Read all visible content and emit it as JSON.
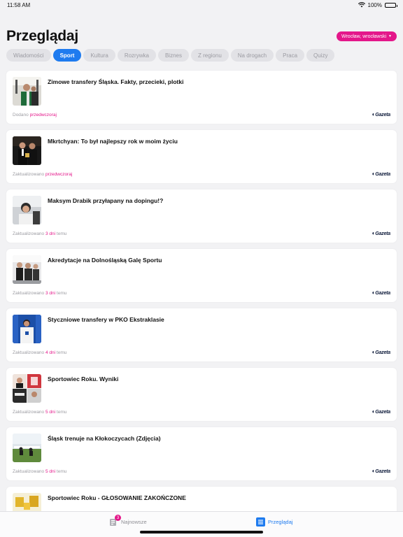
{
  "status": {
    "time": "11:58 AM",
    "battery": "100%"
  },
  "header": {
    "title": "Przeglądaj",
    "location": "Wrocław, wrocławski"
  },
  "tabs": [
    {
      "label": "Wiadomości"
    },
    {
      "label": "Sport"
    },
    {
      "label": "Kultura"
    },
    {
      "label": "Rozrywka"
    },
    {
      "label": "Biznes"
    },
    {
      "label": "Z regionu"
    },
    {
      "label": "Na drogach"
    },
    {
      "label": "Praca"
    },
    {
      "label": "Quizy"
    }
  ],
  "active_tab": "Sport",
  "articles": [
    {
      "title": "Zimowe transfery Śląska. Fakty, przecieki, plotki",
      "meta_label": "Dodano",
      "when": "przedwczoraj",
      "suffix": "",
      "source": "Gazeta"
    },
    {
      "title": "Mkrtchyan: To był najlepszy rok w moim życiu",
      "meta_label": "Zaktualizowano",
      "when": "przedwczoraj",
      "suffix": "",
      "source": "Gazeta"
    },
    {
      "title": "Maksym Drabik przyłapany na dopingu!?",
      "meta_label": "Zaktualizowano",
      "when": "3 dni",
      "suffix": "temu",
      "source": "Gazeta"
    },
    {
      "title": "Akredytacje na Dolnośląską Galę Sportu",
      "meta_label": "Zaktualizowano",
      "when": "3 dni",
      "suffix": "temu",
      "source": "Gazeta"
    },
    {
      "title": "Styczniowe transfery w PKO Ekstraklasie",
      "meta_label": "Zaktualizowano",
      "when": "4 dni",
      "suffix": "temu",
      "source": "Gazeta"
    },
    {
      "title": "Sportowiec Roku. Wyniki",
      "meta_label": "Zaktualizowano",
      "when": "5 dni",
      "suffix": "temu",
      "source": "Gazeta"
    },
    {
      "title": "Śląsk trenuje na Kłokoczycach (Zdjęcia)",
      "meta_label": "Zaktualizowano",
      "when": "5 dni",
      "suffix": "temu",
      "source": "Gazeta"
    },
    {
      "title": "Sportowiec Roku - GŁOSOWANIE ZAKOŃCZONE",
      "meta_label": "",
      "when": "",
      "suffix": "",
      "source": ""
    }
  ],
  "bottom_nav": {
    "newest": {
      "label": "Najnowsze",
      "badge": "3",
      "icon": "newspaper-icon"
    },
    "browse": {
      "label": "Przeglądaj",
      "icon": "list-icon"
    }
  },
  "colors": {
    "accent": "#e4178a",
    "active_tab": "#1e7bef"
  }
}
